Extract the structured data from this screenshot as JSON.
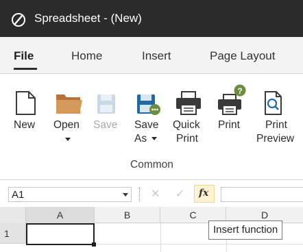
{
  "window": {
    "title": "Spreadsheet - (New)",
    "logo_icon": "spreadsheet-logo-icon"
  },
  "tabs": [
    {
      "label": "File",
      "active": true
    },
    {
      "label": "Home",
      "active": false
    },
    {
      "label": "Insert",
      "active": false
    },
    {
      "label": "Page Layout",
      "active": false
    }
  ],
  "ribbon": {
    "group_label": "Common",
    "commands": {
      "new": {
        "line1": "New",
        "line2": "",
        "icon": "new-document-icon",
        "enabled": true
      },
      "open": {
        "line1": "Open",
        "line2": "",
        "icon": "open-folder-icon",
        "enabled": true,
        "has_dropdown": true
      },
      "save": {
        "line1": "Save",
        "line2": "",
        "icon": "save-icon",
        "enabled": false
      },
      "save_as": {
        "line1": "Save",
        "line2": "As",
        "icon": "save-as-icon",
        "enabled": true,
        "has_dropdown": true
      },
      "quick_print": {
        "line1": "Quick",
        "line2": "Print",
        "icon": "quick-print-icon",
        "enabled": true
      },
      "print": {
        "line1": "Print",
        "line2": "",
        "icon": "print-icon",
        "enabled": true
      },
      "print_preview": {
        "line1": "Print",
        "line2": "Preview",
        "icon": "print-preview-icon",
        "enabled": true
      }
    }
  },
  "formula_bar": {
    "name_box": "A1",
    "formula": "",
    "fx_label": "fx"
  },
  "grid": {
    "columns": [
      "A",
      "B",
      "C",
      "D"
    ],
    "rows": [
      "1"
    ],
    "selected_cell": "A1"
  },
  "tooltip": {
    "text": "Insert function"
  },
  "colors": {
    "titlebar": "#2b2b2b",
    "tabbar": "#f3f3f3",
    "folder": "#d39a5b",
    "save_blue": "#1f6aa5",
    "fx_highlight": "#fdf3d2"
  }
}
